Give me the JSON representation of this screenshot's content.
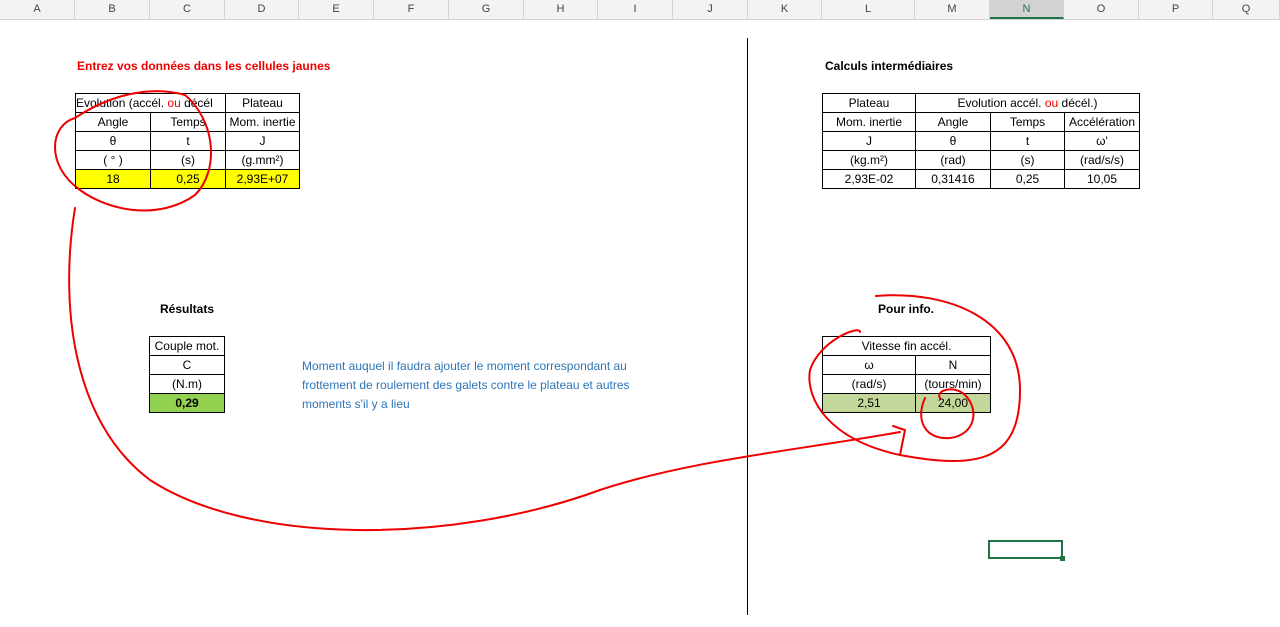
{
  "columns": [
    "A",
    "B",
    "C",
    "D",
    "E",
    "F",
    "G",
    "H",
    "I",
    "J",
    "K",
    "L",
    "M",
    "N",
    "O",
    "P",
    "Q"
  ],
  "selected_column": "N",
  "input_section": {
    "title": "Entrez vos données dans les cellules jaunes",
    "header1": "Evolution (accél. ",
    "header1_ou": "ou",
    "header1_end": " décél",
    "header2": "Plateau",
    "cols": [
      "Angle",
      "Temps",
      "Mom. inertie"
    ],
    "symbols": [
      "θ",
      "t",
      "J"
    ],
    "units": [
      "( ° )",
      "(s)",
      "(g.mm²)"
    ],
    "values": [
      "18",
      "0,25",
      "2,93E+07"
    ]
  },
  "calc_section": {
    "title": "Calculs intermédiaires",
    "header1": "Plateau",
    "header2": "Evolution accél. ",
    "header2_ou": "ou",
    "header2_end": " décél.)",
    "cols": [
      "Mom. inertie",
      "Angle",
      "Temps",
      "Accélération"
    ],
    "symbols": [
      "J",
      "θ",
      "t",
      "ω'"
    ],
    "units": [
      "(kg.m²)",
      "(rad)",
      "(s)",
      "(rad/s/s)"
    ],
    "values": [
      "2,93E-02",
      "0,31416",
      "0,25",
      "10,05"
    ]
  },
  "results": {
    "title": "Résultats",
    "col": "Couple mot.",
    "symbol": "C",
    "unit": "(N.m)",
    "value": "0,29",
    "note": [
      "Moment auquel il faudra ajouter le moment correspondant au",
      "frottement de roulement des galets contre le plateau et autres",
      "moments s'il y a lieu"
    ]
  },
  "info": {
    "title": "Pour info.",
    "header": "Vitesse fin accél.",
    "symbols": [
      "ω",
      "N"
    ],
    "units": [
      "(rad/s)",
      "(tours/min)"
    ],
    "values": [
      "2,51",
      "24,00"
    ]
  }
}
